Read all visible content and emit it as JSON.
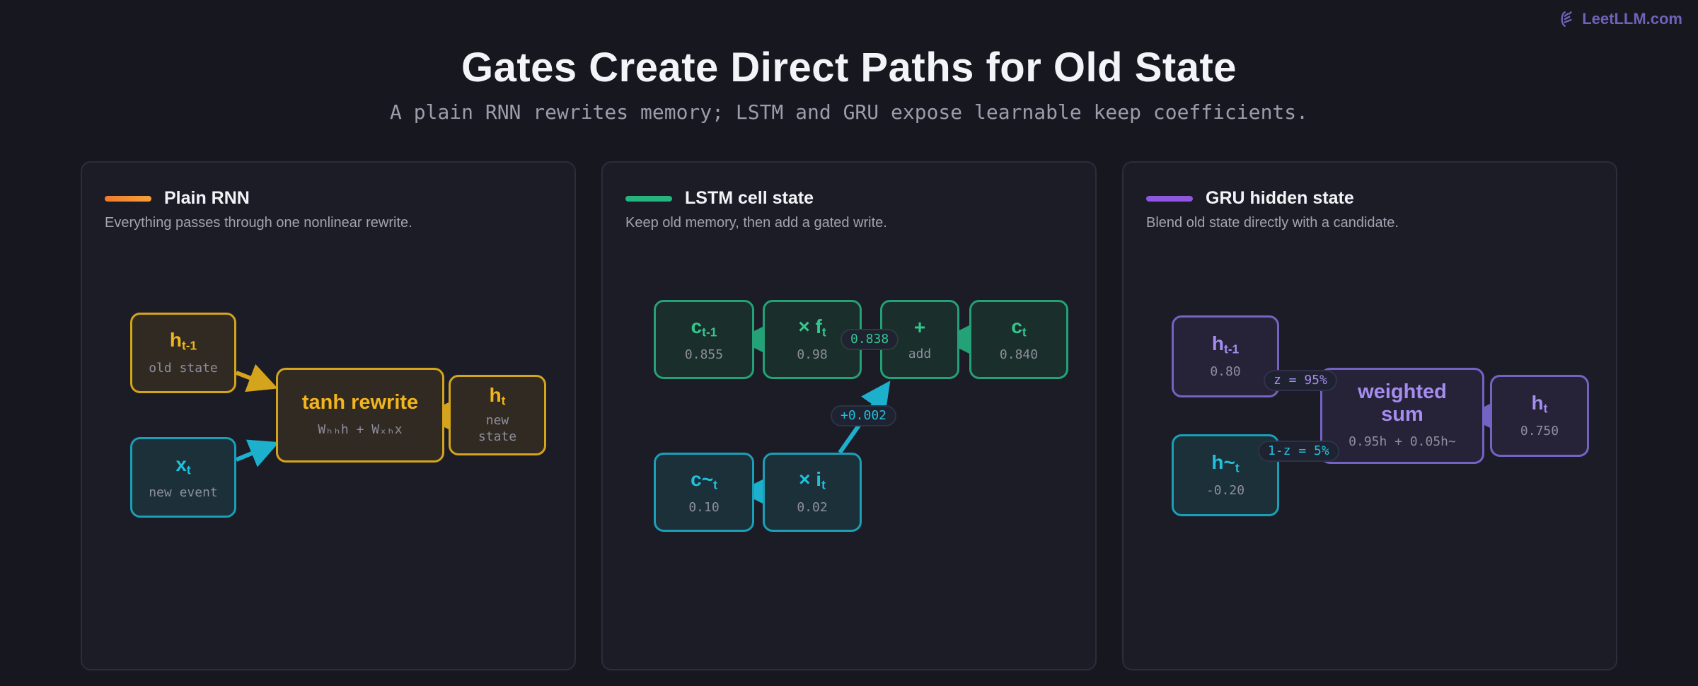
{
  "brand": {
    "text": "LeetLLM.com",
    "icon": "brand-logo-icon"
  },
  "title": "Gates Create Direct Paths for Old State",
  "subtitle": "A plain RNN rewrites memory; LSTM and GRU expose learnable keep coefficients.",
  "colors": {
    "amber": "#d4a41d",
    "teal": "#1b9fb7",
    "green": "#24a176",
    "purple": "#7563c4",
    "background": "#16171f"
  },
  "panels": [
    {
      "title": "Plain RNN",
      "subtitle": "Everything passes through one nonlinear rewrite.",
      "nodes": {
        "h_prev": {
          "base": "h",
          "sub": "t-1",
          "value": "old state"
        },
        "x": {
          "base": "x",
          "sub": "t",
          "value": "new event"
        },
        "tanh": {
          "label": "tanh rewrite",
          "formula": "Wₕₕh + Wₓₕx"
        },
        "h_t": {
          "base": "h",
          "sub": "t",
          "value": "new state"
        }
      }
    },
    {
      "title": "LSTM cell state",
      "subtitle": "Keep old memory, then add a gated write.",
      "nodes": {
        "c_prev": {
          "base": "c",
          "sub": "t-1",
          "value": "0.855"
        },
        "f": {
          "base": "× f",
          "sub": "t",
          "value": "0.98"
        },
        "add": {
          "base": "+",
          "sub": "",
          "value": "add"
        },
        "c_t": {
          "base": "c",
          "sub": "t",
          "value": "0.840"
        },
        "c_tilde": {
          "base": "c~",
          "sub": "t",
          "value": "0.10"
        },
        "i": {
          "base": "× i",
          "sub": "t",
          "value": "0.02"
        }
      },
      "pills": {
        "keep": "0.838",
        "write": "+0.002"
      }
    },
    {
      "title": "GRU hidden state",
      "subtitle": "Blend old state directly with a candidate.",
      "nodes": {
        "h_prev": {
          "base": "h",
          "sub": "t-1",
          "value": "0.80"
        },
        "h_tilde": {
          "base": "h~",
          "sub": "t",
          "value": "-0.20"
        },
        "sum": {
          "label": "weighted sum",
          "formula": "0.95h + 0.05h~"
        },
        "h_t": {
          "base": "h",
          "sub": "t",
          "value": "0.750"
        }
      },
      "pills": {
        "z": "z = 95%",
        "one_minus_z": "1-z = 5%"
      }
    }
  ]
}
